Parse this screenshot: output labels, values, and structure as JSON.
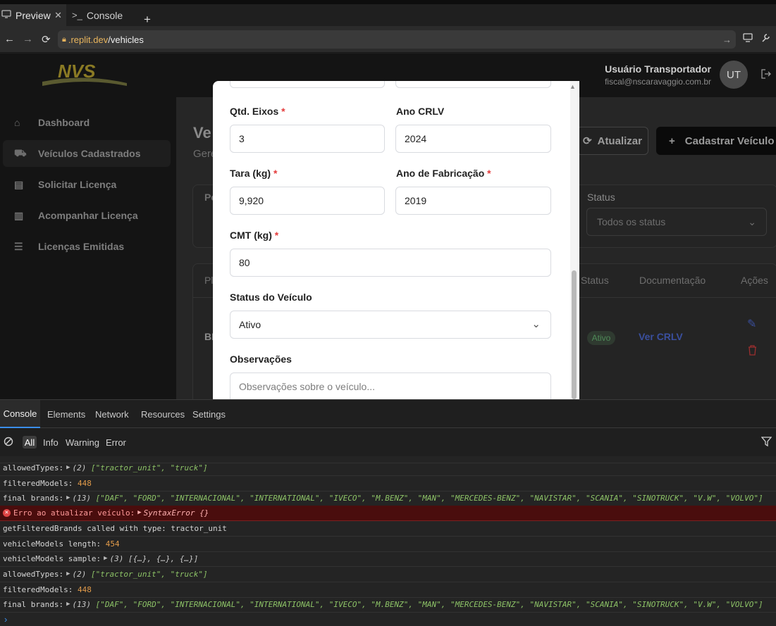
{
  "browser": {
    "tabs": [
      {
        "label": "Preview",
        "icon": "monitor-icon"
      },
      {
        "label": "Console",
        "icon": "terminal-icon"
      }
    ],
    "url_host": ".replit.dev",
    "url_path": "/vehicles"
  },
  "app": {
    "user_name": "Usuário Transportador",
    "user_email": "fiscal@nscaravaggio.com.br",
    "avatar_initials": "UT",
    "nav": [
      {
        "label": "Dashboard",
        "icon": "home-icon"
      },
      {
        "label": "Veículos Cadastrados",
        "icon": "truck-icon"
      },
      {
        "label": "Solicitar Licença",
        "icon": "document-icon"
      },
      {
        "label": "Acompanhar Licença",
        "icon": "clipboard-icon"
      },
      {
        "label": "Licenças Emitidas",
        "icon": "list-check-icon"
      }
    ],
    "refresh_label": "Atualizar",
    "register_label": "Cadastrar Veículo",
    "page_title_partial": "Ve",
    "page_subtitle_partial": "Gere",
    "filter_label_partial": "Pe",
    "status_filter_label": "Status",
    "status_filter_value": "Todos os status",
    "table_headers": {
      "plate_partial": "Pl",
      "status": "Status",
      "doc": "Documentação",
      "actions": "Ações"
    },
    "row_plate_partial": "BI",
    "row_status": "Ativo",
    "row_doc_link": "Ver CRLV"
  },
  "modal": {
    "axles_label": "Qtd. Eixos",
    "axles_value": "3",
    "crlv_year_label": "Ano CRLV",
    "crlv_year_value": "2024",
    "tare_label": "Tara (kg)",
    "tare_value": "9,920",
    "manufacture_year_label": "Ano de Fabricação",
    "manufacture_year_value": "2019",
    "cmt_label": "CMT (kg)",
    "cmt_value": "80",
    "status_label": "Status do Veículo",
    "status_value": "Ativo",
    "notes_label": "Observações",
    "notes_placeholder": "Observações sobre o veículo...",
    "required_mark": "*"
  },
  "devtools": {
    "tabs": [
      "Console",
      "Elements",
      "Network",
      "Resources",
      "Settings"
    ],
    "filters": [
      "All",
      "Info",
      "Warning",
      "Error"
    ],
    "logs": [
      {
        "kind": "array",
        "key": "allowedTypes:",
        "count": "(2)",
        "body": "[\"tractor_unit\", \"truck\"]"
      },
      {
        "kind": "number",
        "key": "filteredModels:",
        "value": "448"
      },
      {
        "kind": "array",
        "key": "final brands:",
        "count": "(13)",
        "body": "[\"DAF\", \"FORD\", \"INTERNACIONAL\", \"INTERNATIONAL\", \"IVECO\", \"M.BENZ\", \"MAN\", \"MERCEDES-BENZ\", \"NAVISTAR\", \"SCANIA\", \"SINOTRUCK\", \"V.W\", \"VOLVO\"]"
      },
      {
        "kind": "error",
        "key": "Erro ao atualizar veículo:",
        "body": "SyntaxError {}"
      },
      {
        "kind": "plain",
        "key": "getFilteredBrands called with type: tractor_unit"
      },
      {
        "kind": "number",
        "key": "vehicleModels length:",
        "value": "454"
      },
      {
        "kind": "object",
        "key": "vehicleModels sample:",
        "count": "(3)",
        "body": "[{…}, {…}, {…}]"
      },
      {
        "kind": "array",
        "key": "allowedTypes:",
        "count": "(2)",
        "body": "[\"tractor_unit\", \"truck\"]"
      },
      {
        "kind": "number",
        "key": "filteredModels:",
        "value": "448"
      },
      {
        "kind": "array",
        "key": "final brands:",
        "count": "(13)",
        "body": "[\"DAF\", \"FORD\", \"INTERNACIONAL\", \"INTERNATIONAL\", \"IVECO\", \"M.BENZ\", \"MAN\", \"MERCEDES-BENZ\", \"NAVISTAR\", \"SCANIA\", \"SINOTRUCK\", \"V.W\", \"VOLVO\"]"
      }
    ]
  },
  "colors": {
    "accent_blue": "#3b8eea",
    "required_red": "#e43b3b",
    "error_bg": "#4a0d0d",
    "brand_gold": "#d4b62a"
  }
}
